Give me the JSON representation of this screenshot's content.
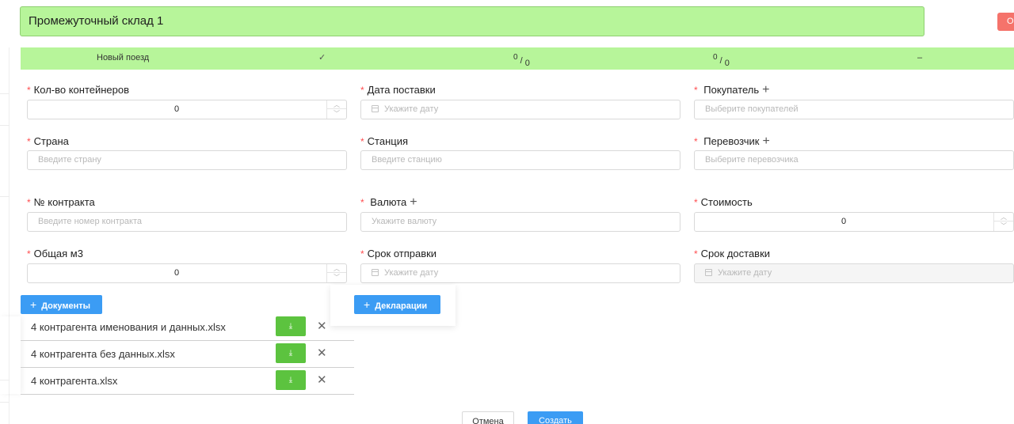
{
  "header": {
    "title": "Промежуточный склад 1",
    "side_button_label": "О"
  },
  "train_row": {
    "name": "Новый поезд",
    "check": "✓",
    "frac1_num": "0",
    "frac1_den": "0",
    "frac2_num": "0",
    "frac2_den": "0",
    "dash": "–"
  },
  "form": {
    "containers": {
      "label": "Кол-во контейнеров",
      "value": "0"
    },
    "delivery_date": {
      "label": "Дата поставки",
      "placeholder": "Укажите дату"
    },
    "buyer": {
      "label": "Покупатель",
      "placeholder": "Выберите покупателей"
    },
    "country": {
      "label": "Страна",
      "placeholder": "Введите страну"
    },
    "station": {
      "label": "Станция",
      "placeholder": "Введите станцию"
    },
    "carrier": {
      "label": "Перевозчик",
      "placeholder": "Выберите перевозчика"
    },
    "contract": {
      "label": "№ контракта",
      "placeholder": "Введите номер контракта"
    },
    "currency": {
      "label": "Валюта",
      "placeholder": "Укажите валюту"
    },
    "cost": {
      "label": "Стоимость",
      "value": "0"
    },
    "volume": {
      "label": "Общая м3",
      "value": "0"
    },
    "ship_term": {
      "label": "Срок отправки",
      "placeholder": "Укажите дату"
    },
    "delivery_term": {
      "label": "Срок доставки",
      "placeholder": "Укажите дату"
    }
  },
  "buttons": {
    "documents": "Документы",
    "declarations": "Декларации",
    "cancel": "Отмена",
    "create": "Создать",
    "plus": "+",
    "required_mark": "*",
    "download_icon": "⤓",
    "close_icon": "✕"
  },
  "files": [
    {
      "name": "4 контрагента  именования и данных.xlsx"
    },
    {
      "name": "4 контрагента без данных.xlsx"
    },
    {
      "name": "4 контрагента.xlsx"
    }
  ],
  "colors": {
    "header_green": "#b7f59a",
    "primary_blue": "#3b9cf4",
    "download_green": "#5cc33f",
    "danger_red": "#f5736b",
    "required_red": "#ff4d4f"
  }
}
